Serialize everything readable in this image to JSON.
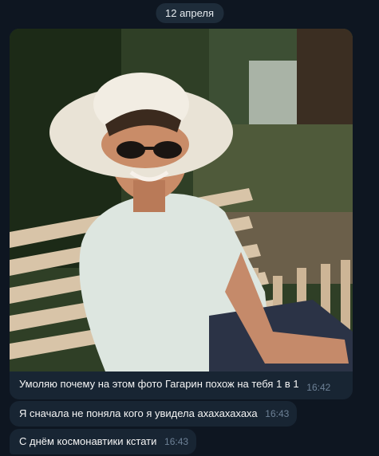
{
  "chat": {
    "date": "12 апреля",
    "messages": [
      {
        "type": "photo",
        "caption": "Умоляю почему на этом фото Гагарин похож на тебя 1 в 1",
        "time": "16:42"
      },
      {
        "type": "text",
        "text": "Я сначала не поняла кого я увидела ахахахахаха",
        "time": "16:43"
      },
      {
        "type": "text",
        "text": "С днём космонавтики кстати",
        "time": "16:43"
      }
    ]
  },
  "colors": {
    "background": "#0e1621",
    "bubble": "#182533",
    "time_text": "#6d8196",
    "date_pill": "#1e2c3a"
  }
}
